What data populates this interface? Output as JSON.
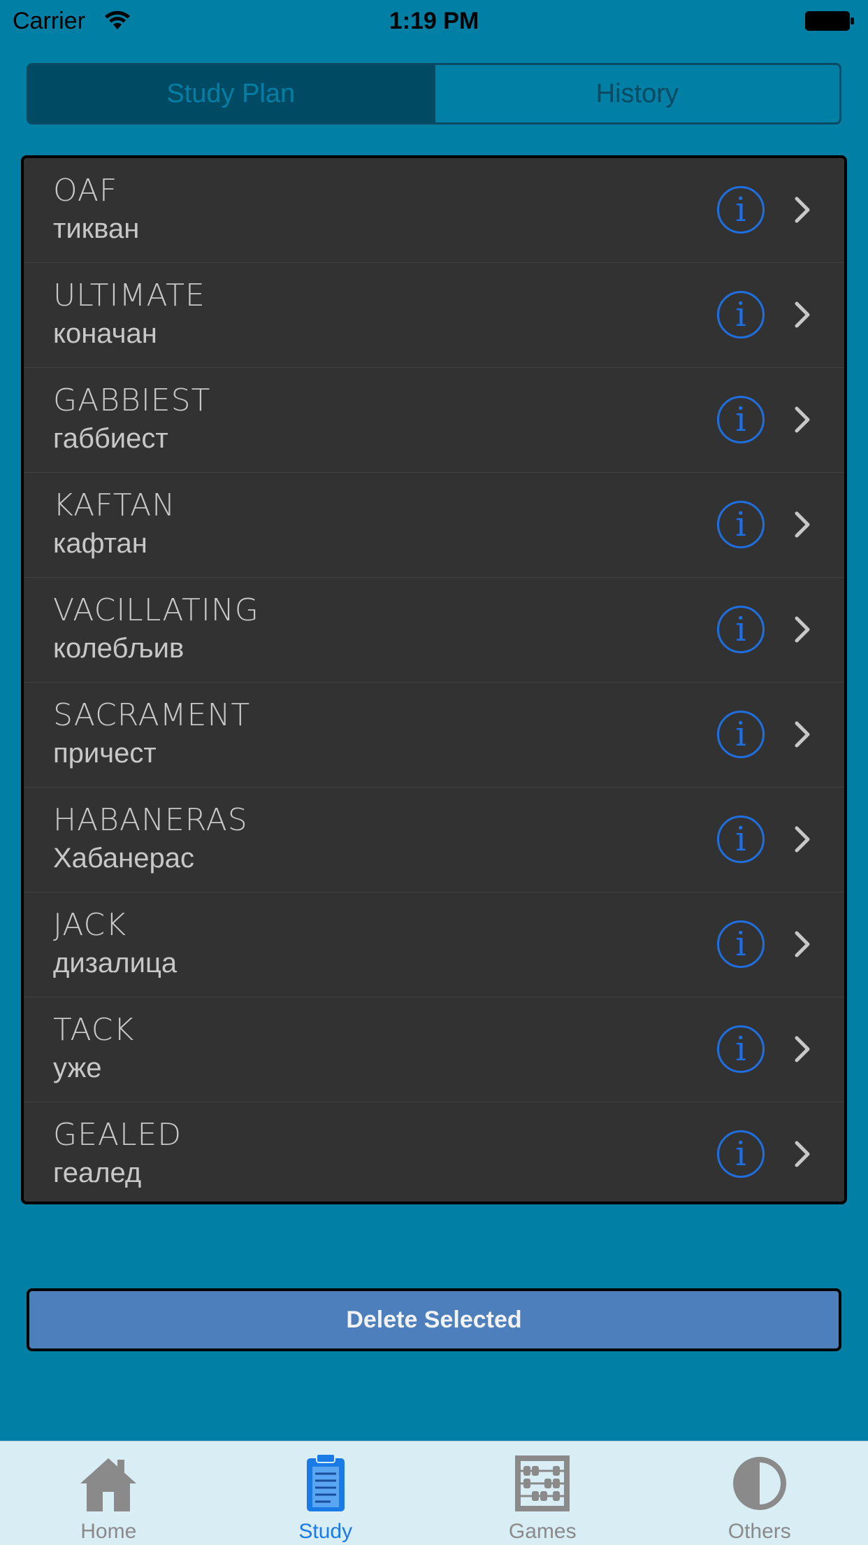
{
  "status_bar": {
    "carrier": "Carrier",
    "time": "1:19 PM"
  },
  "segmented": {
    "items": [
      {
        "label": "Study Plan",
        "selected": true
      },
      {
        "label": "History",
        "selected": false
      }
    ]
  },
  "words": [
    {
      "term": "OAF",
      "translation": "тикван"
    },
    {
      "term": "ULTIMATE",
      "translation": "коначан"
    },
    {
      "term": "GABBIEST",
      "translation": "габбиест"
    },
    {
      "term": "KAFTAN",
      "translation": "кафтан"
    },
    {
      "term": "VACILLATING",
      "translation": "колебљив"
    },
    {
      "term": "SACRAMENT",
      "translation": "причест"
    },
    {
      "term": "HABANERAS",
      "translation": "Хабанерас"
    },
    {
      "term": "JACK",
      "translation": "дизалица"
    },
    {
      "term": "TACK",
      "translation": "уже"
    },
    {
      "term": "GEALED",
      "translation": "геалед"
    }
  ],
  "delete_button": {
    "label": "Delete Selected"
  },
  "tab_bar": {
    "tabs": [
      {
        "label": "Home",
        "icon": "home-icon",
        "active": false
      },
      {
        "label": "Study",
        "icon": "clipboard-icon",
        "active": true
      },
      {
        "label": "Games",
        "icon": "abacus-icon",
        "active": false
      },
      {
        "label": "Others",
        "icon": "half-circle-icon",
        "active": false
      }
    ]
  },
  "colors": {
    "background": "#017fa4",
    "accent": "#1f6fe0",
    "list_background": "#323232",
    "delete_button": "#4d7fbd",
    "tab_bar": "#d9edf5"
  }
}
